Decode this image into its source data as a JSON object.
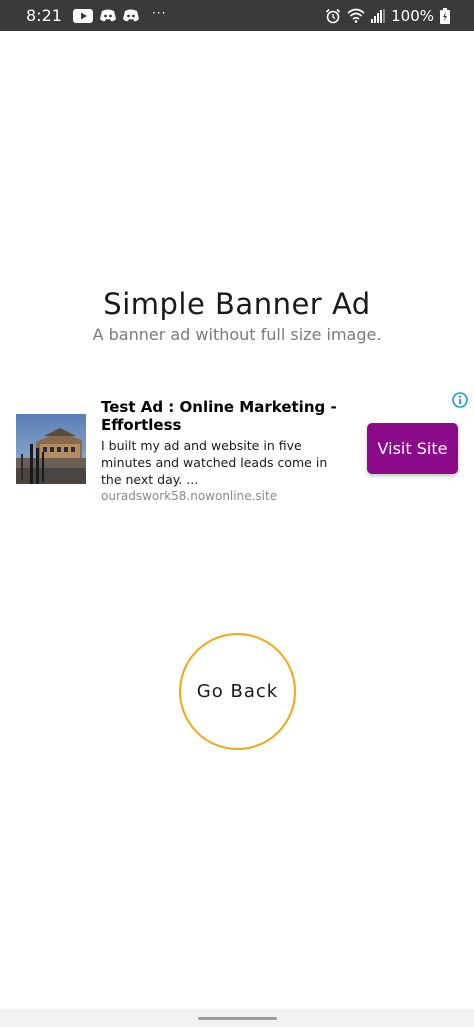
{
  "status_bar": {
    "time": "8:21",
    "left_icons": [
      "youtube-icon",
      "discord-icon",
      "discord-icon"
    ],
    "more_indicator": "···",
    "right_icons": [
      "alarm-icon",
      "wifi-icon",
      "signal-icon"
    ],
    "battery_percent": "100%",
    "battery_icon": "battery-charging-icon"
  },
  "main": {
    "title": "Simple Banner Ad",
    "subtitle": "A banner ad without full size image."
  },
  "ad": {
    "headline": "Test Ad : Online Marketing - Effortless",
    "body": "I built my ad and website in five minutes and watched leads come in the next day. ...",
    "url": "ouradswork58.nowonline.site",
    "cta_label": "Visit Site",
    "cta_color": "#8a0a8a",
    "info_icon": "info-icon",
    "thumbnail": "building-photo"
  },
  "go_back": {
    "label": "Go Back",
    "border_color": "#f0a818"
  },
  "colors": {
    "status_bar_bg": "#3a3a3a",
    "title_text": "#1a1a1a",
    "subtitle_text": "#7a7a7a",
    "ad_info_icon": "#1a9ad6"
  }
}
